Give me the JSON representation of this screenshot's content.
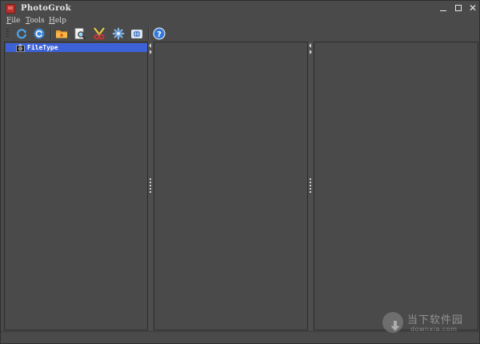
{
  "window": {
    "title": "PhotoGrok",
    "controls": {
      "minimize": "minimize-icon",
      "maximize": "maximize-icon",
      "close": "✕"
    }
  },
  "menu": {
    "items": [
      {
        "mnemonic": "F",
        "rest": "ile"
      },
      {
        "mnemonic": "T",
        "rest": "ools"
      },
      {
        "mnemonic": "H",
        "rest": "elp"
      }
    ]
  },
  "toolbar": {
    "buttons": [
      {
        "icon": "refresh-icon"
      },
      {
        "icon": "reload-icon"
      },
      {
        "icon": "open-folder-icon"
      },
      {
        "icon": "preview-search-icon"
      },
      {
        "icon": "scissors-icon"
      },
      {
        "icon": "settings-gear-icon"
      },
      {
        "icon": "globe-icon"
      },
      {
        "icon": "help-icon"
      }
    ]
  },
  "tree": {
    "items": [
      {
        "label": "FileType",
        "selected": true,
        "icon": "filetype-camera-icon"
      }
    ]
  },
  "watermark": {
    "text_cn": "当下软件园",
    "url": "downxia.com"
  },
  "colors": {
    "background": "#4a4a4a",
    "selection": "#3d62d8",
    "text": "#e6e6e6"
  }
}
